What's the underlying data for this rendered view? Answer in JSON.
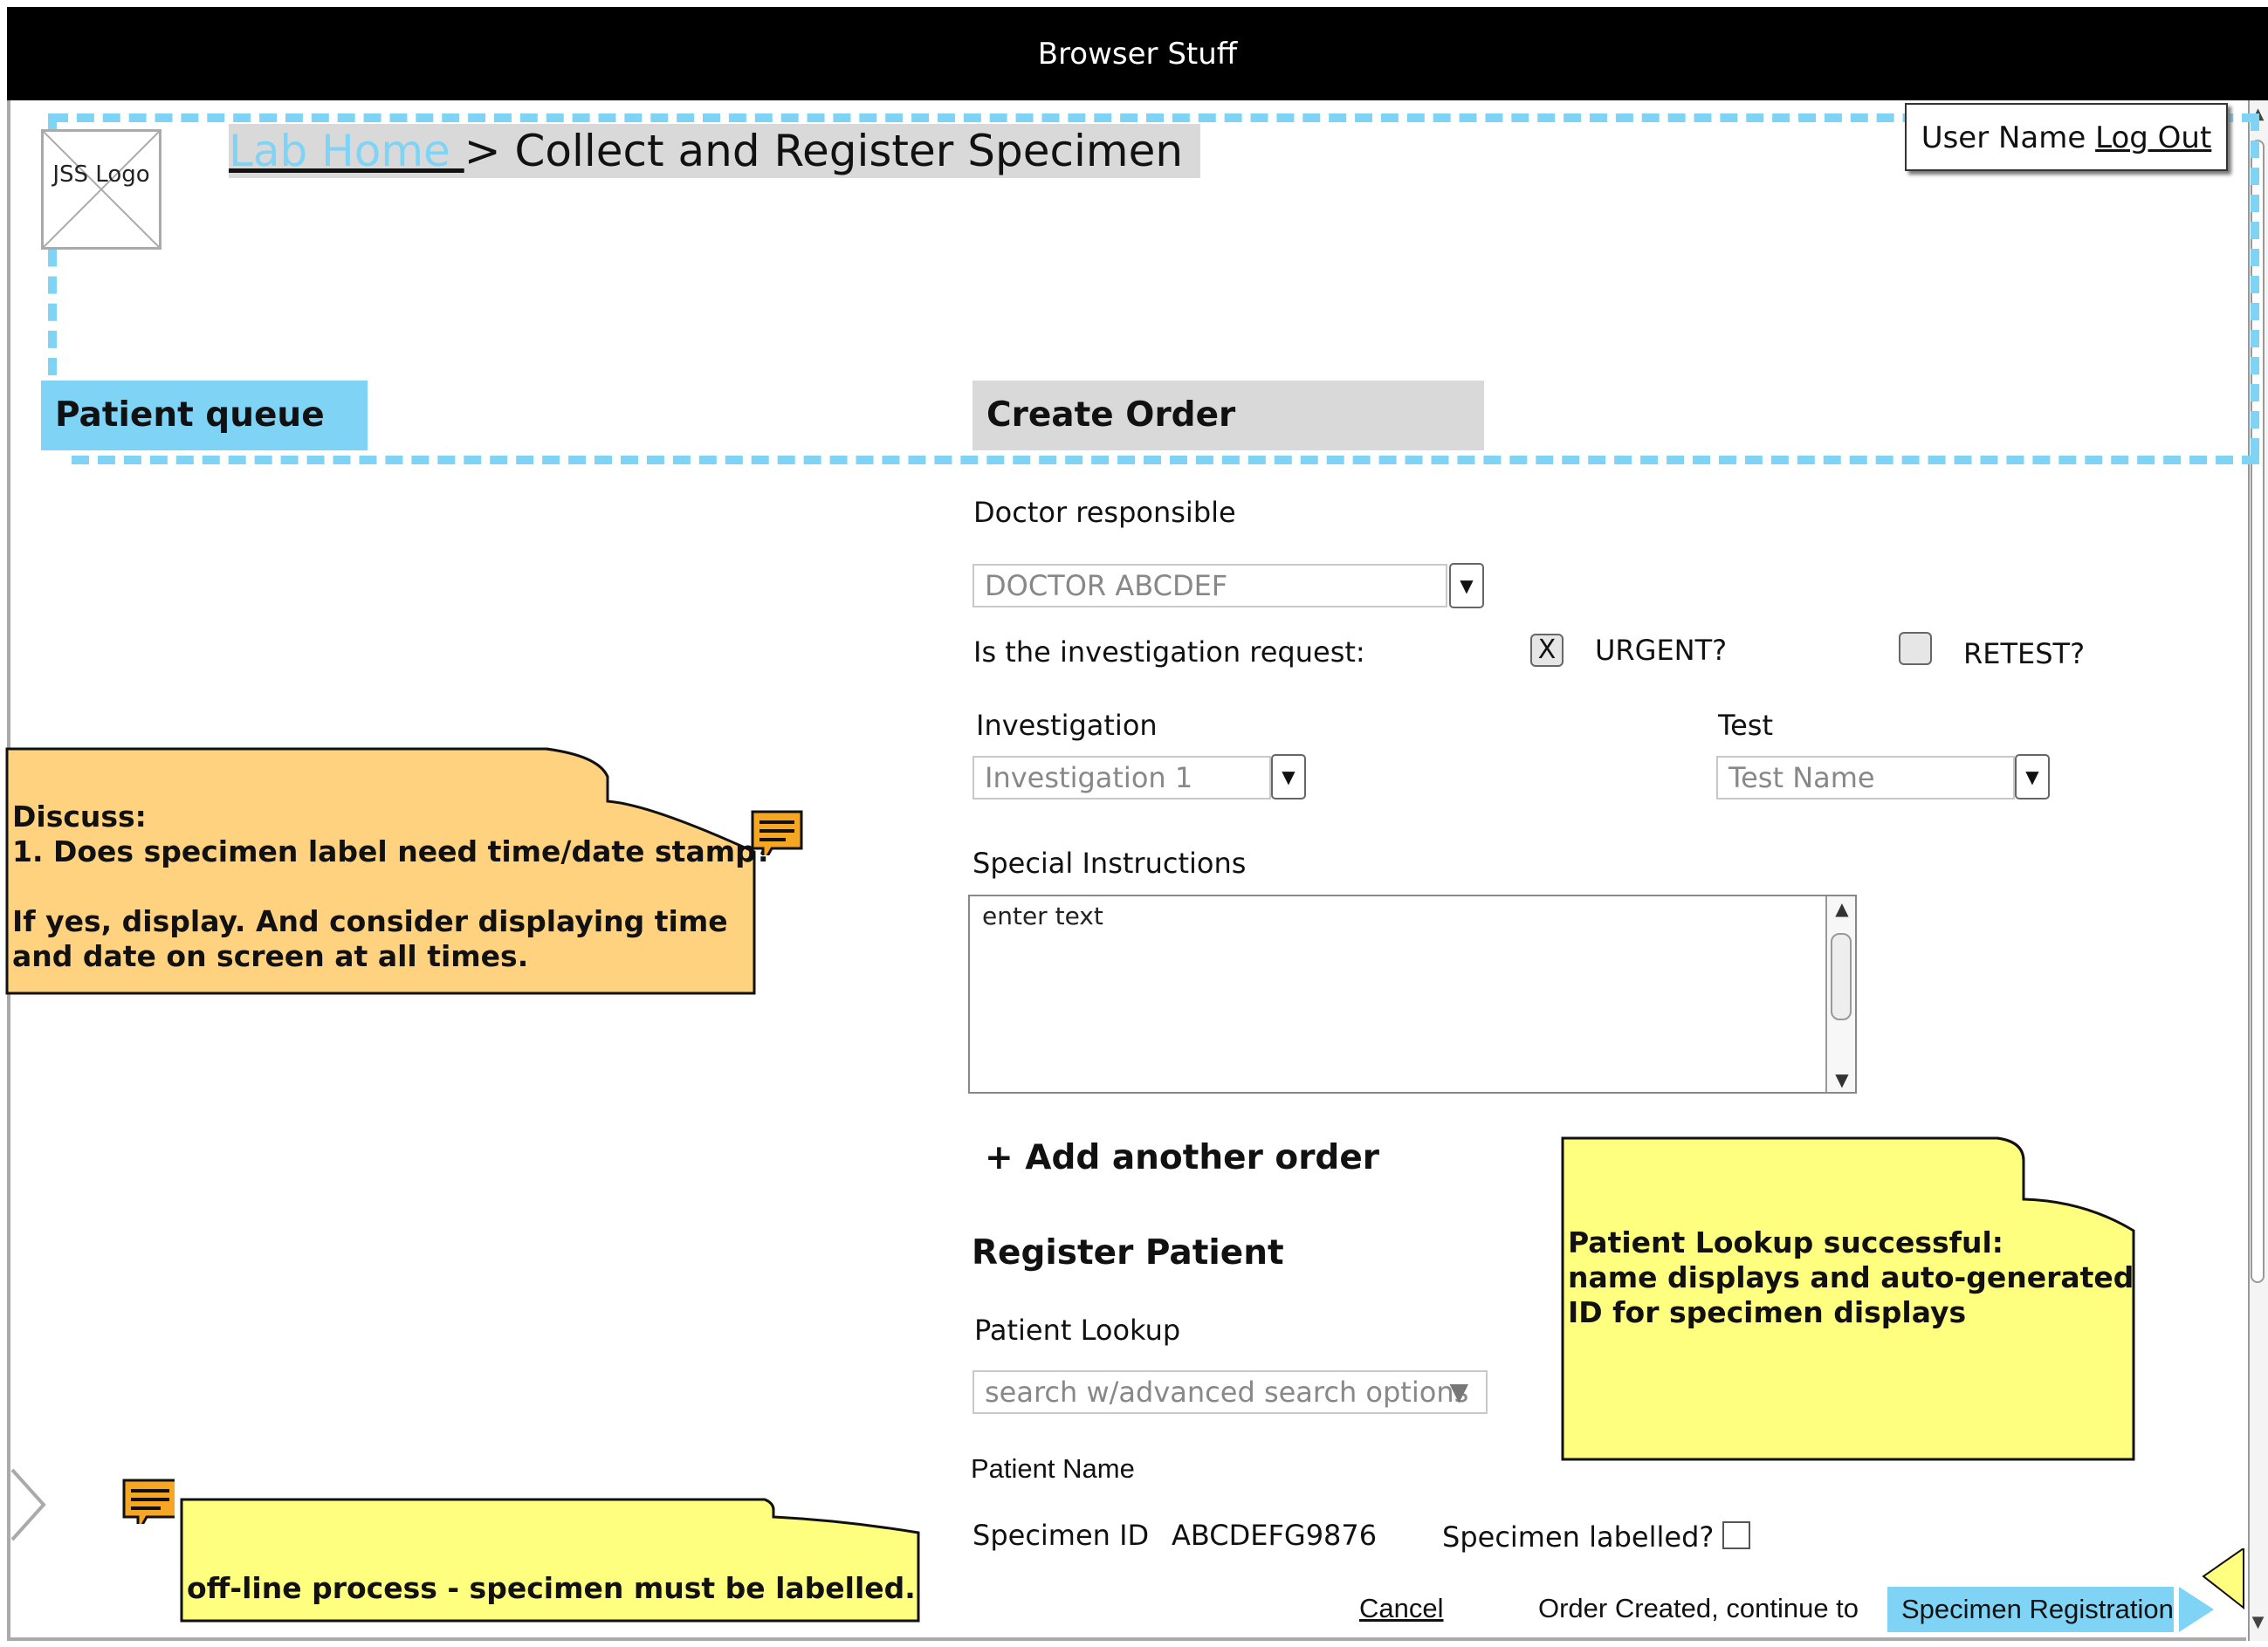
{
  "browser": {
    "title": "Browser Stuff"
  },
  "logo": {
    "text": "JSS Logo"
  },
  "breadcrumb": {
    "link": "Lab Home ",
    "separator": ">",
    "current": "Collect and Register Specimen"
  },
  "user": {
    "name": "User Name",
    "logout": "Log Out"
  },
  "tabs": {
    "queue": "Patient queue",
    "order": "Create Order"
  },
  "order": {
    "doctor_label": "Doctor responsible",
    "doctor_value": "DOCTOR ABCDEF",
    "request_label": "Is the investigation request:",
    "urgent_label": "URGENT?",
    "urgent_checked": "X",
    "retest_label": "RETEST?",
    "investigation_label": "Investigation",
    "investigation_value": "Investigation 1",
    "test_label": "Test",
    "test_value": "Test Name",
    "special_label": "Special Instructions",
    "special_value": "enter text",
    "add_another": "+ Add another order"
  },
  "register": {
    "heading": "Register Patient",
    "lookup_label": "Patient Lookup",
    "lookup_placeholder": "search w/advanced search options",
    "patient_name_label": "Patient Name",
    "specimen_id_label": "Specimen ID",
    "specimen_id_value": "ABCDEFG9876",
    "labelled_label": "Specimen labelled?"
  },
  "footer": {
    "cancel": "Cancel",
    "continue_text": "Order Created, continue to",
    "primary": "Specimen Registration"
  },
  "notes": {
    "discuss": "Discuss:\n1. Does specimen label need time/date stamp?\n\nIf yes, display. And consider displaying time\nand date on screen at all times.",
    "lookup": "Patient Lookup successful:\nname displays and auto-generated\nID  for specimen displays",
    "offline": "off-line process - specimen must be labelled."
  },
  "colors": {
    "accent": "#7fd4f6",
    "note_orange": "#ffd27f",
    "note_yellow": "#ffff7f",
    "comment_icon": "#f5a623"
  }
}
